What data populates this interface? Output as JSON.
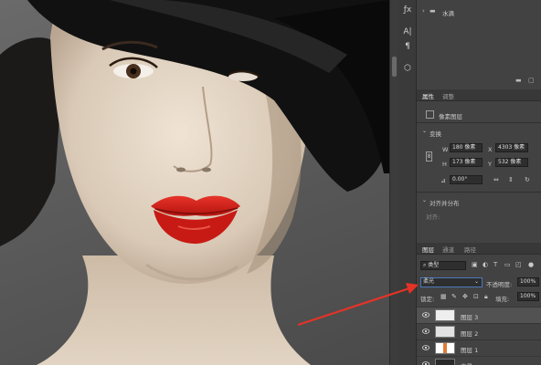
{
  "layers_top": {
    "group_name": "水滴"
  },
  "properties": {
    "tab_properties": "属性",
    "tab_adjustments": "调整",
    "pixel_layer": "像素图层",
    "transform_section": "变换",
    "w_label": "W",
    "w_value": "180 像素",
    "x_label": "X",
    "x_value": "4303 像素",
    "h_label": "H",
    "h_value": "173 像素",
    "y_label": "Y",
    "y_value": "532 像素",
    "angle_value": "0.00°",
    "align_section": "对齐并分布",
    "align_label": "对齐:"
  },
  "layers_panel": {
    "tab_layers": "图层",
    "tab_channels": "通道",
    "tab_paths": "路径",
    "kind_filter": "类型",
    "blend_mode": "柔光",
    "opacity_label": "不透明度:",
    "opacity_value": "100%",
    "lock_label": "锁定:",
    "fill_label": "填充:",
    "fill_value": "100%",
    "layers": [
      {
        "name": "图层 3",
        "selected": true
      },
      {
        "name": "图层 2",
        "selected": false
      },
      {
        "name": "图层 1",
        "selected": false
      },
      {
        "name": "背景",
        "selected": false
      }
    ]
  },
  "colors": {
    "panel_bg": "#424242",
    "lip_red": "#d8221c",
    "hat": "#111111",
    "arrow_red": "#e53326",
    "selection_highlight": "#525252"
  }
}
